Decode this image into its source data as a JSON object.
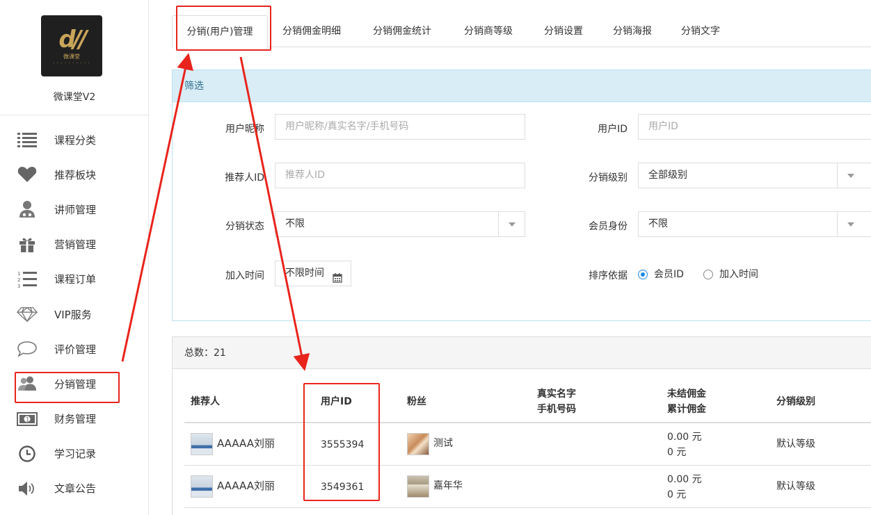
{
  "app": {
    "logo_text": "微课堂",
    "name": "微课堂V2"
  },
  "sidebar": {
    "items": [
      {
        "label": "课程分类",
        "icon": "list-icon"
      },
      {
        "label": "推荐板块",
        "icon": "heart-icon"
      },
      {
        "label": "讲师管理",
        "icon": "teacher-icon"
      },
      {
        "label": "营销管理",
        "icon": "gift-icon"
      },
      {
        "label": "课程订单",
        "icon": "ordered-list-icon"
      },
      {
        "label": "VIP服务",
        "icon": "diamond-icon"
      },
      {
        "label": "评价管理",
        "icon": "comment-icon"
      },
      {
        "label": "分销管理",
        "icon": "users-icon"
      },
      {
        "label": "财务管理",
        "icon": "money-icon"
      },
      {
        "label": "学习记录",
        "icon": "clock-icon"
      },
      {
        "label": "文章公告",
        "icon": "speaker-icon"
      }
    ]
  },
  "tabs": [
    {
      "label": "分销(用户)管理",
      "active": true
    },
    {
      "label": "分销佣金明细"
    },
    {
      "label": "分销佣金统计"
    },
    {
      "label": "分销商等级"
    },
    {
      "label": "分销设置"
    },
    {
      "label": "分销海报"
    },
    {
      "label": "分销文字"
    }
  ],
  "filter": {
    "title": "筛选",
    "nickname": {
      "label": "用户昵称",
      "placeholder": "用户昵称/真实名字/手机号码"
    },
    "user_id": {
      "label": "用户ID",
      "placeholder": "用户ID"
    },
    "referrer_id": {
      "label": "推荐人ID",
      "placeholder": "推荐人ID"
    },
    "level": {
      "label": "分销级别",
      "value": "全部级别"
    },
    "status": {
      "label": "分销状态",
      "value": "不限"
    },
    "member": {
      "label": "会员身份",
      "value": "不限"
    },
    "join_time": {
      "label": "加入时间",
      "value": "不限时间"
    },
    "sort": {
      "label": "排序依据",
      "options": [
        "会员ID",
        "加入时间"
      ],
      "selected": "会员ID"
    }
  },
  "results": {
    "total_label": "总数：21",
    "columns": {
      "referrer": "推荐人",
      "user_id": "用户ID",
      "fans": "粉丝",
      "realname": "真实名字",
      "phone": "手机号码",
      "pending": "未结佣金",
      "total": "累计佣金",
      "level": "分销级别"
    },
    "rows": [
      {
        "referrer": "AAAAA刘丽",
        "user_id": "3555394",
        "fans": "测试",
        "pending": "0.00 元",
        "total": "0 元",
        "level": "默认等级"
      },
      {
        "referrer": "AAAAA刘丽",
        "user_id": "3549361",
        "fans": "嘉年华",
        "pending": "0.00 元",
        "total": "0 元",
        "level": "默认等级"
      }
    ]
  },
  "colors": {
    "annotation": "#e8241c",
    "filter_header_bg": "#d9edf7",
    "filter_header_text": "#31708f",
    "radio_accent": "#1e88e5"
  }
}
